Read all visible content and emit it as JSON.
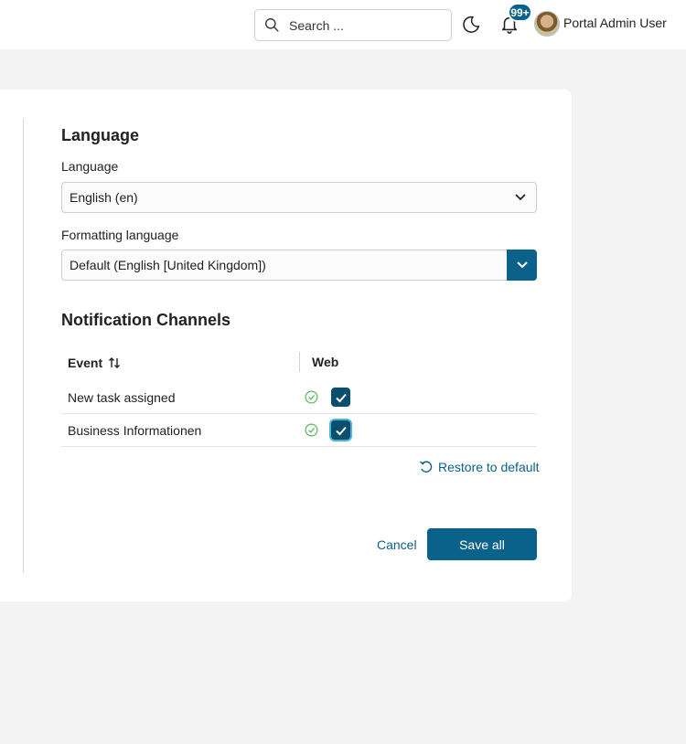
{
  "header": {
    "search_placeholder": "Search ...",
    "notification_count": "99+",
    "user_name": "Portal Admin User"
  },
  "language_section": {
    "title": "Language",
    "language_label": "Language",
    "language_value": "English (en)",
    "formatting_label": "Formatting language",
    "formatting_value": "Default (English [United Kingdom])"
  },
  "notifications": {
    "title": "Notification Channels",
    "columns": {
      "event": "Event",
      "web": "Web"
    },
    "rows": [
      {
        "event": "New task assigned",
        "web_checked": true
      },
      {
        "event": "Business Informationen",
        "web_checked": true
      }
    ],
    "restore_label": "Restore to default"
  },
  "actions": {
    "cancel_label": "Cancel",
    "save_label": "Save all"
  },
  "colors": {
    "accent": "#0a6189",
    "check_bg": "#0a4f6e",
    "ok_green": "#5cb85c"
  },
  "icons": [
    "search-icon",
    "moon-icon",
    "bell-icon",
    "chevron-down-icon",
    "sort-icon",
    "check-circle-icon",
    "checkmark-icon",
    "restore-icon"
  ]
}
